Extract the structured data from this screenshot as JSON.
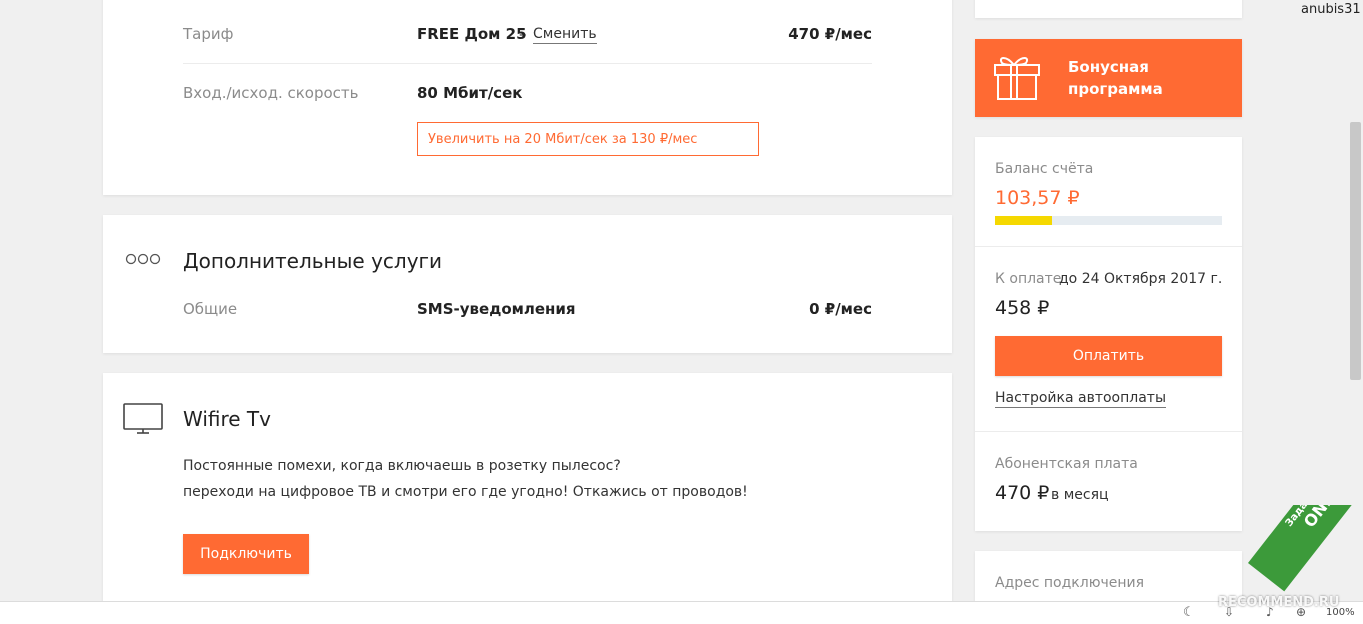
{
  "tariff_card": {
    "tariff_label": "Тариф",
    "tariff_name": "FREE Дом 25",
    "dash": "–",
    "change_link": "Сменить",
    "tariff_price": "470 ₽/мес",
    "speed_label": "Вход./исход. скорость",
    "speed_value": "80 Мбит/сек",
    "upgrade_button": "Увеличить на 20 Мбит/сек за 130 ₽/мес"
  },
  "extras_card": {
    "icon": "dots-icon",
    "title": "Дополнительные услуги",
    "category_label": "Общие",
    "service_name": "SMS-уведомления",
    "service_price": "0 ₽/мес"
  },
  "tv_card": {
    "icon": "tv-icon",
    "title": "Wifire Tv",
    "desc_line1": "Постоянные помехи, когда включаешь в розетку пылесос?",
    "desc_line2": "переходи на цифровое ТВ и смотри его где угодно! Откажись от проводов!",
    "connect_button": "Подключить"
  },
  "sidebar": {
    "username": "anubis31",
    "bonus": {
      "icon": "gift-icon",
      "line1": "Бонусная",
      "line2": "программа",
      "color": "#ff6a33"
    },
    "balance": {
      "label": "Баланс счёта",
      "value": "103,57 ₽",
      "fill_fraction": 0.25,
      "bar_color": "#f5d800"
    },
    "payment": {
      "label": "К оплате",
      "due": "до 24 Октября 2017 г.",
      "amount": "458 ₽",
      "pay_button": "Оплатить",
      "autopay_link": "Настройка автооплаты"
    },
    "subscription": {
      "label": "Абонентская плата",
      "amount": "470 ₽",
      "period": "в месяц"
    },
    "address": {
      "label": "Адрес подключения"
    }
  },
  "overlay": {
    "watermark": "RECOMMEND.RU",
    "ribbon_line1": "Задайте вопрос",
    "ribbon_line2": "ONLINE",
    "zoom": "100%"
  },
  "colors": {
    "accent": "#ff6a33",
    "background": "#f0f0f0"
  }
}
